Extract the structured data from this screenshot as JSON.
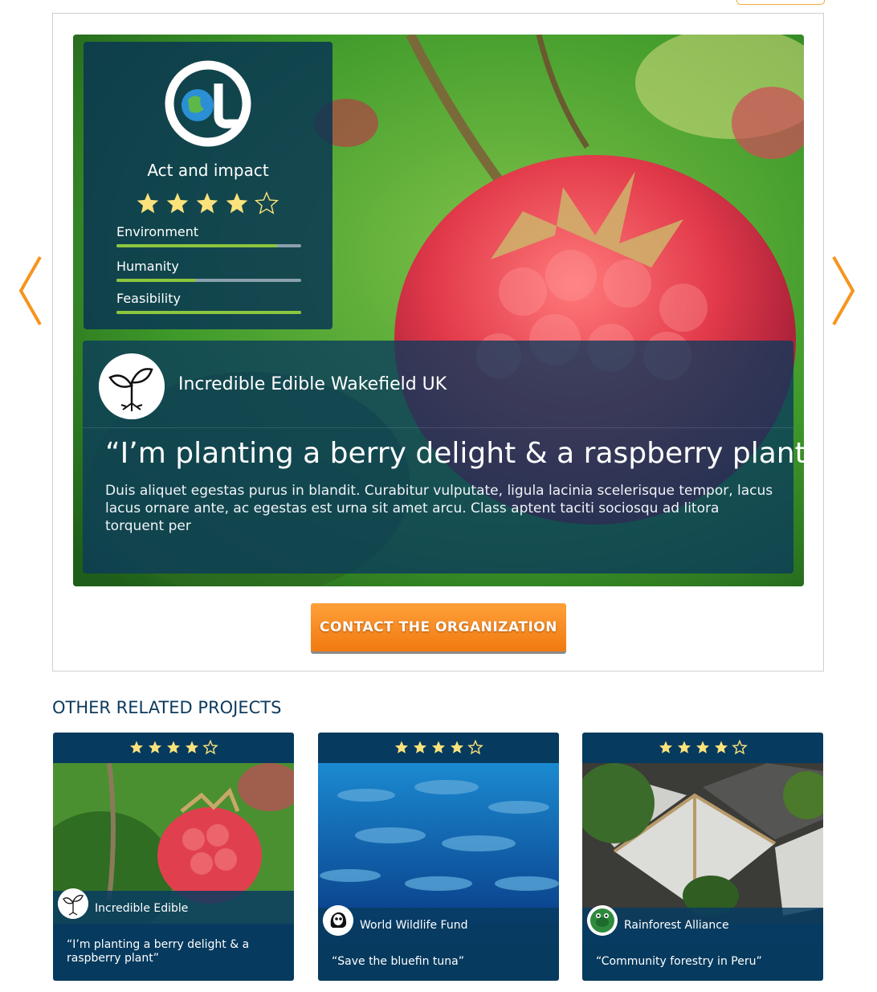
{
  "featured": {
    "rating_title": "Act and impact",
    "rating_stars": 4,
    "rating_max": 5,
    "metrics": [
      {
        "label": "Environment",
        "value": 0.87
      },
      {
        "label": "Humanity",
        "value": 0.43
      },
      {
        "label": "Feasibility",
        "value": 1.0
      }
    ],
    "org_name": "Incredible Edible Wakefield UK",
    "quote": "“I’m planting a berry delight & a raspberry plant”",
    "description": "Duis aliquet egestas purus in blandit. Curabitur vulputate, ligula lacinia scelerisque tempor, lacus lacus ornare ante, ac egestas est urna sit amet arcu. Class aptent taciti sociosqu ad litora torquent per",
    "icons": {
      "logo": "act-and-impact-logo",
      "avatar": "sprouting-plant-icon",
      "prev": "chevron-left-icon",
      "next": "chevron-right-icon"
    }
  },
  "contact_button": "CONTACT THE ORGANIZATION",
  "related": {
    "title": "OTHER RELATED PROJECTS",
    "cards": [
      {
        "stars": 4,
        "org": "Incredible Edible",
        "quote": "“I’m planting a berry delight & a raspberry plant”",
        "icon": "sprouting-plant-icon"
      },
      {
        "stars": 4,
        "org": "World Wildlife Fund",
        "quote": "“Save the bluefin tuna”",
        "icon": "wwf-panda-icon"
      },
      {
        "stars": 4,
        "org": "Rainforest Alliance",
        "quote": "“Community forestry in Peru”",
        "icon": "frog-icon"
      }
    ]
  },
  "colors": {
    "panel": "#083454",
    "accent_green": "#8cc63f",
    "orange": "#f7941d",
    "star": "#fbe27b",
    "heading": "#0c3a5e"
  }
}
